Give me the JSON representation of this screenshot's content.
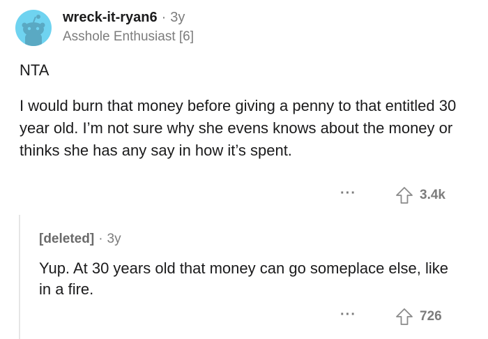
{
  "comment": {
    "username": "wreck-it-ryan6",
    "separator": "·",
    "age": "3y",
    "flair": "Asshole Enthusiast [6]",
    "verdict": "NTA",
    "body": "I would burn that money before giving a penny to that entitled 30 year old. I’m not sure why she evens knows about the money or thinks she has any say in how it’s spent.",
    "more_label": "···",
    "upvotes": "3.4k",
    "avatar_icon": "snoo-avatar-icon",
    "avatar_color": "#6fd3f0"
  },
  "reply": {
    "username": "[deleted]",
    "separator": "·",
    "age": "3y",
    "body": "Yup.  At 30 years old that money can go someplace else, like in a fire.",
    "more_label": "···",
    "upvotes": "726"
  }
}
